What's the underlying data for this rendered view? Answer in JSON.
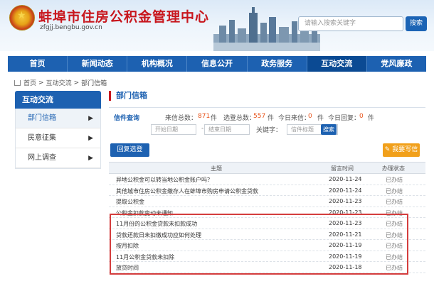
{
  "site": {
    "title": "蚌埠市住房公积金管理中心",
    "url": "zfgjj.bengbu.gov.cn"
  },
  "search": {
    "placeholder": "请输入搜索关键字",
    "button_label": "搜索"
  },
  "nav": {
    "items": [
      {
        "label": "首页"
      },
      {
        "label": "新闻动态"
      },
      {
        "label": "机构概况"
      },
      {
        "label": "信息公开"
      },
      {
        "label": "政务服务"
      },
      {
        "label": "互动交流"
      },
      {
        "label": "党风廉政"
      }
    ],
    "active": "互动交流"
  },
  "breadcrumb": {
    "items": [
      "首页",
      ">",
      "互动交流",
      ">",
      "部门信箱"
    ]
  },
  "sidebar": {
    "title": "互动交流",
    "items": [
      {
        "label": "部门信箱",
        "arrow": "▶"
      },
      {
        "label": "民意征集",
        "arrow": "▶"
      },
      {
        "label": "网上调查",
        "arrow": "▶"
      }
    ]
  },
  "main": {
    "title": "部门信箱",
    "query_label": "信件查询",
    "stats": {
      "total_label": "来信总数：",
      "total": "871",
      "total_unit": "件",
      "selected_label": "选登总数：",
      "selected": "557",
      "selected_unit": "件",
      "today_in_label": "今日来信：",
      "today_in": "0",
      "today_in_unit": "件",
      "today_reply_label": "今日回复：",
      "today_reply": "0",
      "today_reply_unit": "件"
    },
    "filter": {
      "start_placeholder": "开始日期",
      "dash": "-",
      "end_placeholder": "结束日期",
      "keyword_label": "关键字：",
      "keyword_placeholder": "信件标题",
      "button_label": "搜索"
    },
    "reply_button": "回复选登",
    "write_button": "我要写信",
    "table": {
      "headers": {
        "topic": "主题",
        "time": "留言时间",
        "status": "办理状态"
      },
      "rows": [
        {
          "topic": "异地公积金可以转当地公积金账户吗？",
          "time": "2020-11-24",
          "status": "已办结"
        },
        {
          "topic": "其他城市住房公积金缴存人在蚌埠市购房申请公积金贷款",
          "time": "2020-11-24",
          "status": "已办结"
        },
        {
          "topic": "提取公积金",
          "time": "2020-11-23",
          "status": "已办结"
        },
        {
          "topic": "公积金扣款变动未通知",
          "time": "2020-11-23",
          "status": "已办结"
        },
        {
          "topic": "11月份的公积金贷款未扣款成功",
          "time": "2020-11-23",
          "status": "已办结"
        },
        {
          "topic": "贷款还款日未扣缴成功应如何处理",
          "time": "2020-11-21",
          "status": "已办结"
        },
        {
          "topic": "按月扣除",
          "time": "2020-11-19",
          "status": "已办结"
        },
        {
          "topic": "11月公积金贷款未扣除",
          "time": "2020-11-19",
          "status": "已办结"
        },
        {
          "topic": "放贷时间",
          "time": "2020-11-18",
          "status": "已办结"
        }
      ]
    }
  },
  "colors": {
    "brand_blue": "#1d61b1",
    "title_red": "#c8161d",
    "accent_orange": "#f1a01b",
    "highlight_red": "#d43d3d"
  }
}
